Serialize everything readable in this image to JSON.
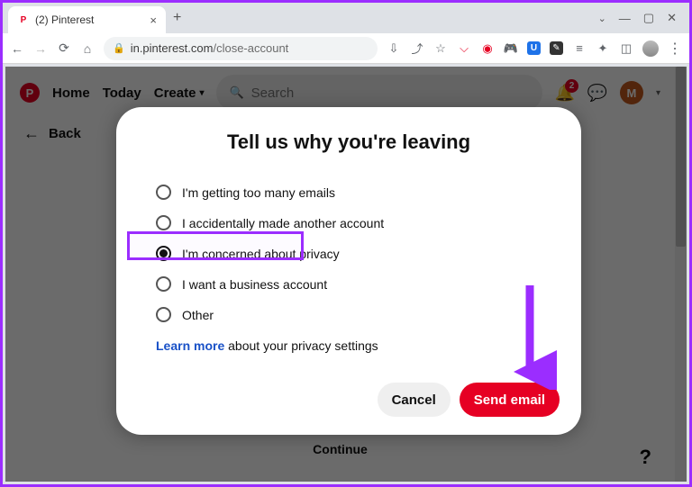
{
  "browser": {
    "tab_title": "(2) Pinterest",
    "url_domain": "in.pinterest.com",
    "url_path": "/close-account",
    "new_tab_symbol": "+",
    "close_tab_symbol": "×",
    "window_tabdrop": "⌄",
    "window_min": "—",
    "window_max": "▢",
    "window_close": "✕",
    "menu": "⋮"
  },
  "nav": {
    "home": "Home",
    "today": "Today",
    "create": "Create",
    "search_placeholder": "Search",
    "bell_badge": "2",
    "avatar_initial": "M",
    "back": "Back",
    "continue": "Continue",
    "help": "?"
  },
  "modal": {
    "title": "Tell us why you're leaving",
    "options": [
      "I'm getting too many emails",
      "I accidentally made another account",
      "I'm concerned about privacy",
      "I want a business account",
      "Other"
    ],
    "selected_index": 2,
    "learn_more_link": "Learn more",
    "learn_more_rest": " about your privacy settings",
    "cancel": "Cancel",
    "send": "Send email"
  }
}
